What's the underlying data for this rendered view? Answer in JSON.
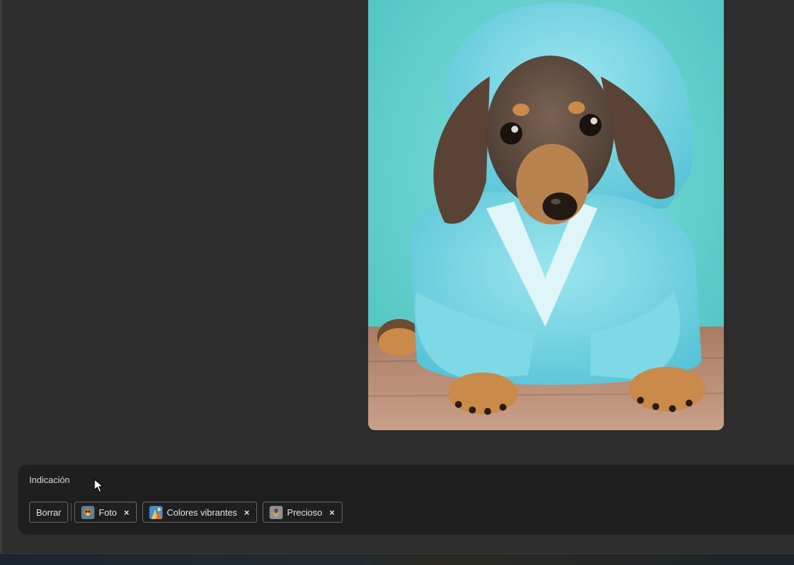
{
  "prompt": {
    "label": "Indicación",
    "clear_label": "Borrar",
    "chips": [
      {
        "label": "Foto",
        "thumb_icon": "photo-style-thumbnail",
        "close_glyph": "×"
      },
      {
        "label": "Colores vibrantes",
        "thumb_icon": "vibrant-colors-thumbnail",
        "close_glyph": "×"
      },
      {
        "label": "Precioso",
        "thumb_icon": "precious-style-thumbnail",
        "close_glyph": "×"
      }
    ]
  },
  "image": {
    "subject_icon": "dachshund-puppy-in-blue-bathrobe-image"
  },
  "colors": {
    "background": "#2d2d2d",
    "panel": "#1f1f1f",
    "image_backdrop": "#62d2d0",
    "robe": "#6fd0e0"
  }
}
